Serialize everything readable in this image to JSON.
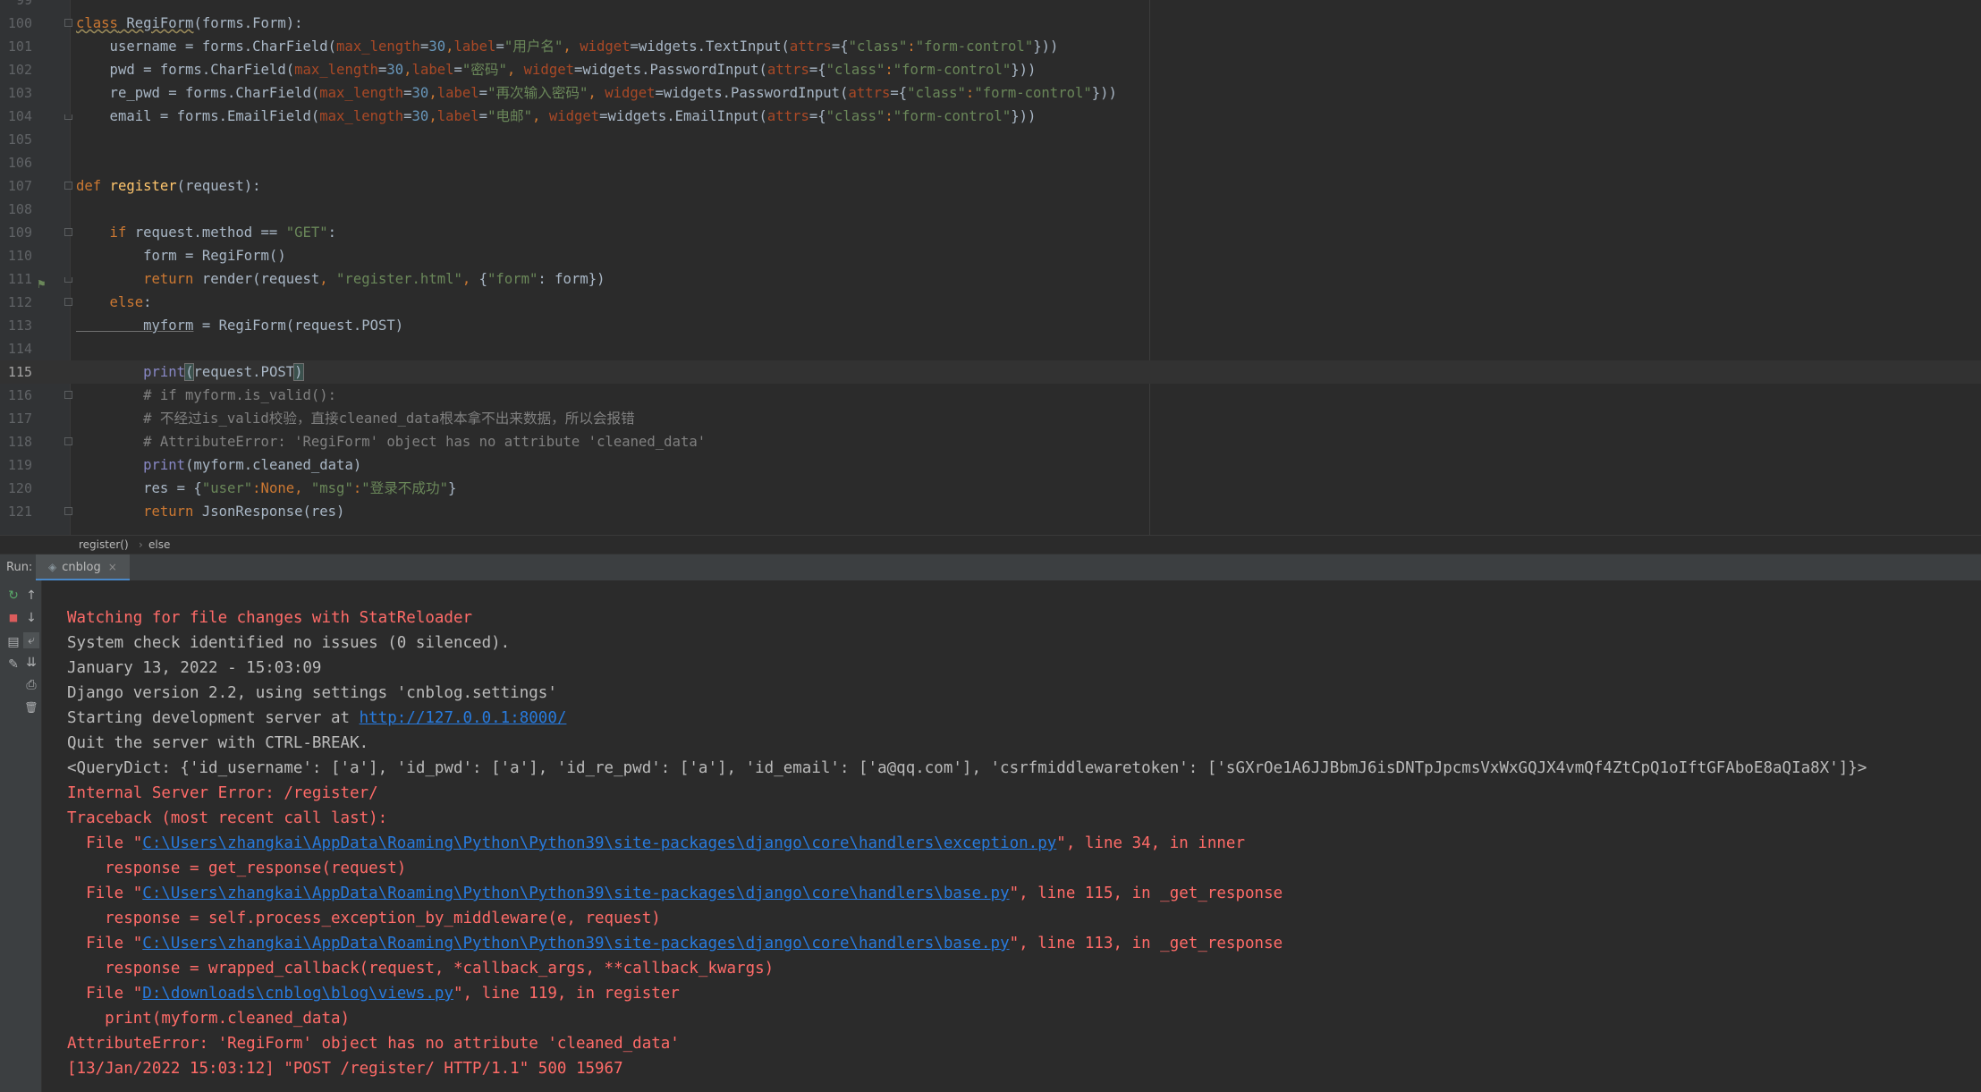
{
  "editor": {
    "lines": [
      {
        "n": "99",
        "parts": []
      },
      {
        "n": "100",
        "parts": [
          [
            "kw err-ul",
            "class"
          ],
          [
            "err-ul",
            " RegiForm"
          ],
          [
            "",
            "(forms.Form):"
          ]
        ]
      },
      {
        "n": "101",
        "parts": [
          [
            "",
            "    username = forms.CharField("
          ],
          [
            "param",
            "max_length"
          ],
          [
            "",
            "="
          ],
          [
            "num",
            "30"
          ],
          [
            "kw",
            ","
          ],
          [
            "param",
            "label"
          ],
          [
            "",
            "="
          ],
          [
            "str",
            "\"用户名\""
          ],
          [
            "kw",
            ", "
          ],
          [
            "param",
            "widget"
          ],
          [
            "",
            "=widgets.TextInput("
          ],
          [
            "param",
            "attrs"
          ],
          [
            "",
            "={"
          ],
          [
            "str",
            "\"class\""
          ],
          [
            "kw",
            ":"
          ],
          [
            "str",
            "\"form-control\""
          ],
          [
            "",
            "}))"
          ]
        ]
      },
      {
        "n": "102",
        "parts": [
          [
            "",
            "    pwd = forms.CharField("
          ],
          [
            "param",
            "max_length"
          ],
          [
            "",
            "="
          ],
          [
            "num",
            "30"
          ],
          [
            "kw",
            ","
          ],
          [
            "param",
            "label"
          ],
          [
            "",
            "="
          ],
          [
            "str",
            "\"密码\""
          ],
          [
            "kw",
            ", "
          ],
          [
            "param",
            "widget"
          ],
          [
            "",
            "=widgets.PasswordInput("
          ],
          [
            "param",
            "attrs"
          ],
          [
            "",
            "={"
          ],
          [
            "str",
            "\"class\""
          ],
          [
            "kw",
            ":"
          ],
          [
            "str",
            "\"form-control\""
          ],
          [
            "",
            "}))"
          ]
        ]
      },
      {
        "n": "103",
        "parts": [
          [
            "",
            "    re_pwd = forms.CharField("
          ],
          [
            "param",
            "max_length"
          ],
          [
            "",
            "="
          ],
          [
            "num",
            "30"
          ],
          [
            "kw",
            ","
          ],
          [
            "param",
            "label"
          ],
          [
            "",
            "="
          ],
          [
            "str",
            "\"再次输入密码\""
          ],
          [
            "kw",
            ", "
          ],
          [
            "param",
            "widget"
          ],
          [
            "",
            "=widgets.PasswordInput("
          ],
          [
            "param",
            "attrs"
          ],
          [
            "",
            "={"
          ],
          [
            "str",
            "\"class\""
          ],
          [
            "kw",
            ":"
          ],
          [
            "str",
            "\"form-control\""
          ],
          [
            "",
            "}))"
          ]
        ]
      },
      {
        "n": "104",
        "parts": [
          [
            "",
            "    email = forms.EmailField("
          ],
          [
            "param",
            "max_length"
          ],
          [
            "",
            "="
          ],
          [
            "num",
            "30"
          ],
          [
            "kw",
            ","
          ],
          [
            "param",
            "label"
          ],
          [
            "",
            "="
          ],
          [
            "str",
            "\"电邮\""
          ],
          [
            "kw",
            ", "
          ],
          [
            "param",
            "widget"
          ],
          [
            "",
            "=widgets.EmailInput("
          ],
          [
            "param",
            "attrs"
          ],
          [
            "",
            "={"
          ],
          [
            "str",
            "\"class\""
          ],
          [
            "kw",
            ":"
          ],
          [
            "str",
            "\"form-control\""
          ],
          [
            "",
            "}))"
          ]
        ]
      },
      {
        "n": "105",
        "parts": []
      },
      {
        "n": "106",
        "parts": []
      },
      {
        "n": "107",
        "parts": [
          [
            "kw",
            "def "
          ],
          [
            "fn",
            "register"
          ],
          [
            "",
            "(request):"
          ]
        ]
      },
      {
        "n": "108",
        "parts": []
      },
      {
        "n": "109",
        "parts": [
          [
            "kw",
            "    if "
          ],
          [
            "",
            "request.method == "
          ],
          [
            "str",
            "\"GET\""
          ],
          [
            "",
            ":"
          ]
        ]
      },
      {
        "n": "110",
        "parts": [
          [
            "",
            "        form = RegiForm()"
          ]
        ]
      },
      {
        "n": "111",
        "parts": [
          [
            "kw",
            "        return "
          ],
          [
            "",
            "render(request"
          ],
          [
            "kw",
            ", "
          ],
          [
            "str",
            "\"register.html\""
          ],
          [
            "kw",
            ", "
          ],
          [
            "",
            "{"
          ],
          [
            "str",
            "\"form\""
          ],
          [
            "",
            ": form})"
          ]
        ]
      },
      {
        "n": "112",
        "parts": [
          [
            "kw",
            "    else"
          ],
          [
            "",
            ":"
          ]
        ]
      },
      {
        "n": "113",
        "parts": [
          [
            "self-ul",
            "        myform"
          ],
          [
            "",
            " = RegiForm(request.POST)"
          ]
        ]
      },
      {
        "n": "114",
        "parts": []
      },
      {
        "n": "115",
        "parts": [
          [
            "builtin",
            "        print"
          ],
          [
            "bracket-hl",
            "("
          ],
          [
            "",
            "request.POST"
          ],
          [
            "bracket-hl",
            ")"
          ]
        ]
      },
      {
        "n": "116",
        "parts": [
          [
            "cmt",
            "        # if myform.is_valid():"
          ]
        ]
      },
      {
        "n": "117",
        "parts": [
          [
            "cmt",
            "        # 不经过is_valid校验，直接cleaned_data根本拿不出来数据，所以会报错"
          ]
        ]
      },
      {
        "n": "118",
        "parts": [
          [
            "cmt",
            "        # AttributeError: 'RegiForm' object has no attribute 'cleaned_data'"
          ]
        ]
      },
      {
        "n": "119",
        "parts": [
          [
            "builtin",
            "        print"
          ],
          [
            "",
            "(myform.cleaned_data)"
          ]
        ]
      },
      {
        "n": "120",
        "parts": [
          [
            "",
            "        res = {"
          ],
          [
            "str",
            "\"user\""
          ],
          [
            "kw",
            ":None, "
          ],
          [
            "str",
            "\"msg\""
          ],
          [
            "kw",
            ":"
          ],
          [
            "str",
            "\"登录不成功\""
          ],
          [
            "",
            "}"
          ]
        ]
      },
      {
        "n": "121",
        "parts": [
          [
            "kw",
            "        return "
          ],
          [
            "",
            "JsonResponse(res)"
          ]
        ]
      }
    ]
  },
  "breadcrumb": {
    "func": "register()",
    "sep": "›",
    "block": "else"
  },
  "run": {
    "label": "Run:",
    "tab": "cnblog",
    "close": "×"
  },
  "console": {
    "lines": [
      [
        [
          "c-red",
          "Watching for file changes with StatReloader"
        ]
      ],
      [
        [
          "c-white",
          "System check identified no issues (0 silenced)."
        ]
      ],
      [
        [
          "c-white",
          "January 13, 2022 - 15:03:09"
        ]
      ],
      [
        [
          "c-white",
          "Django version 2.2, using settings 'cnblog.settings'"
        ]
      ],
      [
        [
          "c-white",
          "Starting development server at "
        ],
        [
          "c-link",
          "http://127.0.0.1:8000/"
        ]
      ],
      [
        [
          "c-white",
          "Quit the server with CTRL-BREAK."
        ]
      ],
      [
        [
          "c-white",
          "<QueryDict: {'id_username': ['a'], 'id_pwd': ['a'], 'id_re_pwd': ['a'], 'id_email': ['a@qq.com'], 'csrfmiddlewaretoken': ['sGXrOe1A6JJBbmJ6isDNTpJpcmsVxWxGQJX4vmQf4ZtCpQ1oIftGFAboE8aQIa8X']}>"
        ]
      ],
      [
        [
          "c-red",
          "Internal Server Error: /register/"
        ]
      ],
      [
        [
          "c-red",
          "Traceback (most recent call last):"
        ]
      ],
      [
        [
          "c-red",
          "  File \""
        ],
        [
          "c-link",
          "C:\\Users\\zhangkai\\AppData\\Roaming\\Python\\Python39\\site-packages\\django\\core\\handlers\\exception.py"
        ],
        [
          "c-red",
          "\", line 34, in inner"
        ]
      ],
      [
        [
          "c-red",
          "    response = get_response(request)"
        ]
      ],
      [
        [
          "c-red",
          "  File \""
        ],
        [
          "c-link",
          "C:\\Users\\zhangkai\\AppData\\Roaming\\Python\\Python39\\site-packages\\django\\core\\handlers\\base.py"
        ],
        [
          "c-red",
          "\", line 115, in _get_response"
        ]
      ],
      [
        [
          "c-red",
          "    response = self.process_exception_by_middleware(e, request)"
        ]
      ],
      [
        [
          "c-red",
          "  File \""
        ],
        [
          "c-link",
          "C:\\Users\\zhangkai\\AppData\\Roaming\\Python\\Python39\\site-packages\\django\\core\\handlers\\base.py"
        ],
        [
          "c-red",
          "\", line 113, in _get_response"
        ]
      ],
      [
        [
          "c-red",
          "    response = wrapped_callback(request, *callback_args, **callback_kwargs)"
        ]
      ],
      [
        [
          "c-red",
          "  File \""
        ],
        [
          "c-link",
          "D:\\downloads\\cnblog\\blog\\views.py"
        ],
        [
          "c-red",
          "\", line 119, in register"
        ]
      ],
      [
        [
          "c-red",
          "    print(myform.cleaned_data)"
        ]
      ],
      [
        [
          "c-red",
          "AttributeError: 'RegiForm' object has no attribute 'cleaned_data'"
        ]
      ],
      [
        [
          "c-red",
          "[13/Jan/2022 15:03:12] \"POST /register/ HTTP/1.1\" 500 15967"
        ]
      ]
    ]
  },
  "toolbar": {
    "rerun_icon": "↻",
    "stop_icon": "■",
    "layout_icon": "▤",
    "pin_icon": "✎",
    "up_icon": "↑",
    "down_icon": "↓",
    "wrap_icon": "⤶",
    "scroll_end_icon": "⇊",
    "print_icon": "⎙",
    "trash_icon": "🗑"
  },
  "gutter_icon": "⚑"
}
